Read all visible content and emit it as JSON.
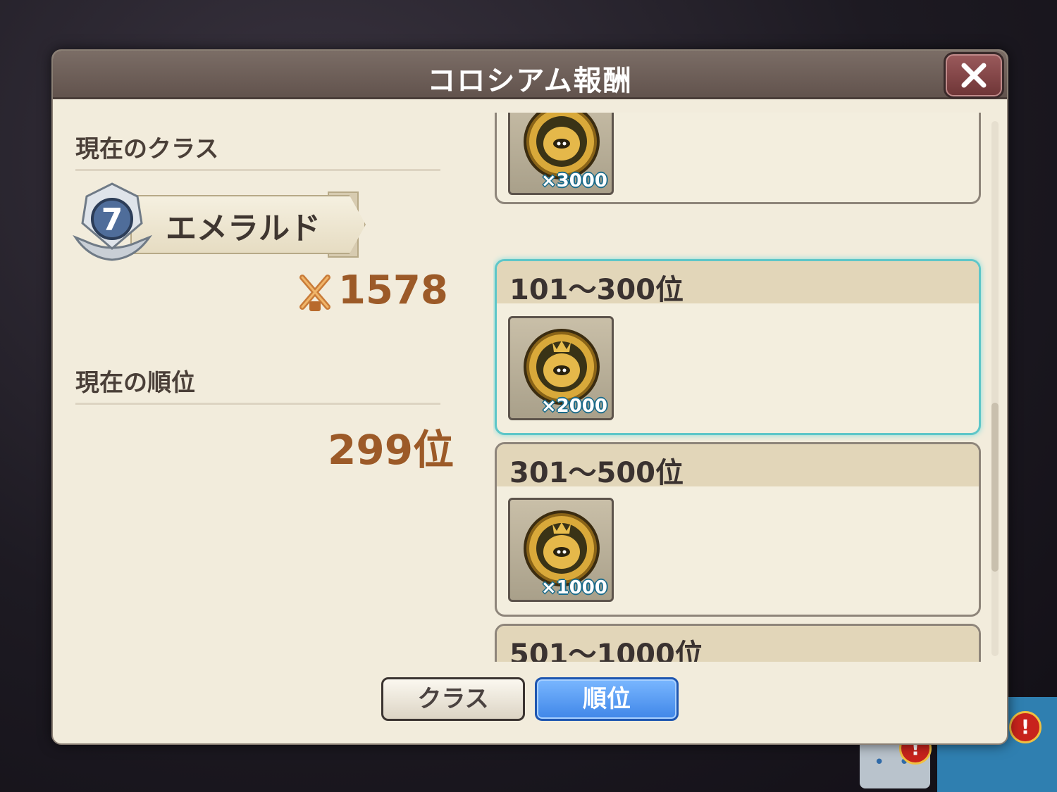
{
  "dialog": {
    "title": "コロシアム報酬",
    "close_icon": "close-x-icon"
  },
  "left": {
    "class_section_label": "現在のクラス",
    "class_level": "7",
    "class_name": "エメラルド",
    "score_icon": "crossed-swords-icon",
    "score": "1578",
    "rank_section_label": "現在の順位",
    "rank": "299位"
  },
  "rewards": [
    {
      "label": "",
      "quantity": "×3000",
      "icon": "gold-coin-icon"
    },
    {
      "label": "101～300位",
      "quantity": "×2000",
      "icon": "gold-coin-icon",
      "highlighted": true
    },
    {
      "label": "301～500位",
      "quantity": "×1000",
      "icon": "gold-coin-icon"
    },
    {
      "label": "501～1000位",
      "quantity": "",
      "icon": "gold-coin-icon"
    }
  ],
  "tabs": {
    "class_label": "クラス",
    "rank_label": "順位",
    "selected": "rank"
  },
  "colors": {
    "accent_orange": "#9c5a28",
    "selected_tab_blue": "#3f86e8",
    "highlight_teal": "#5ec6c8"
  }
}
